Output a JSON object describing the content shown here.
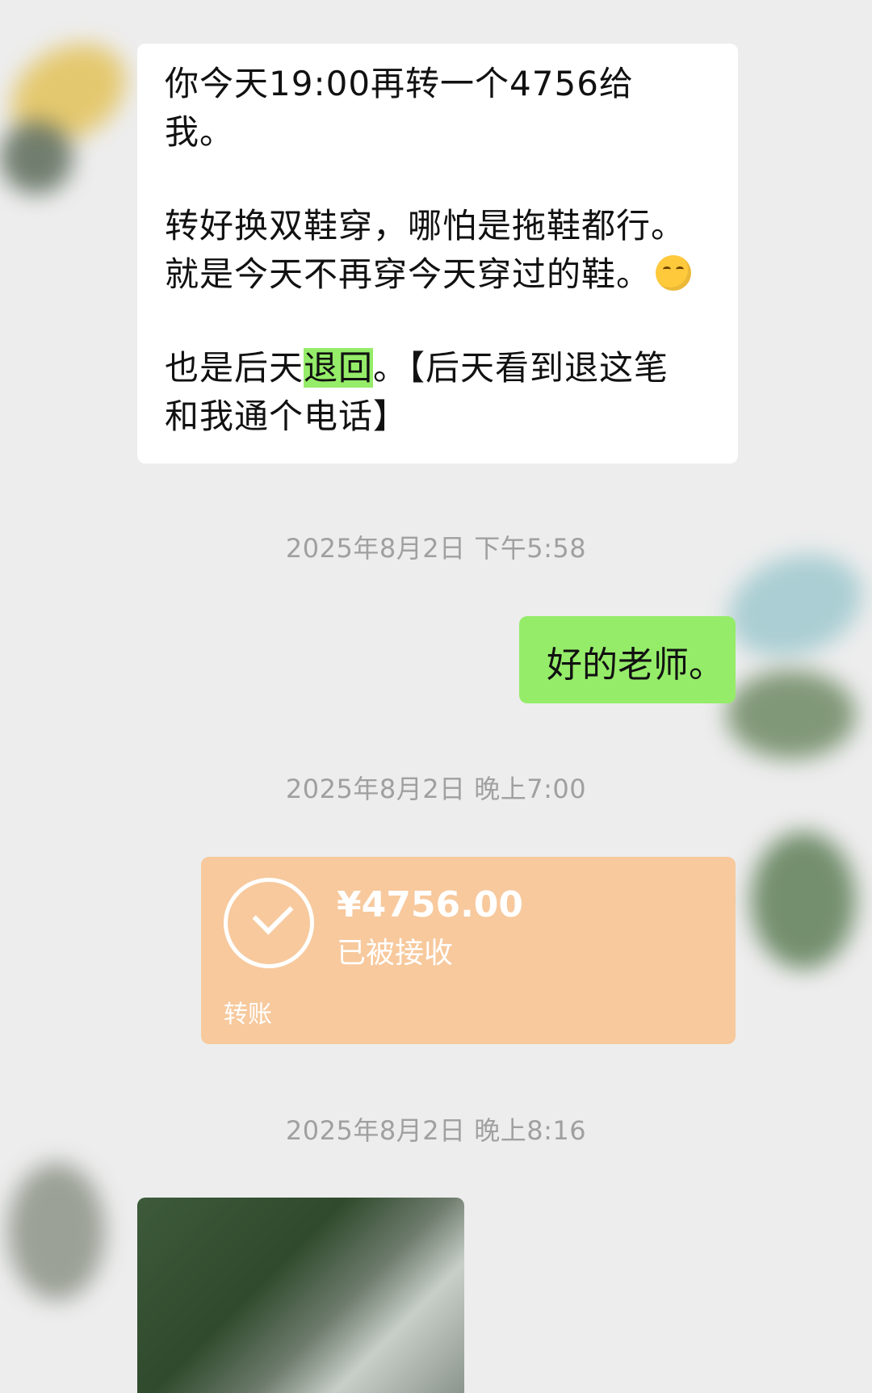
{
  "messages": {
    "incoming": {
      "line1": "你今天19:00再转一个4756给",
      "line2": "我。",
      "line3": "转好换双鞋穿，哪怕是拖鞋都行。",
      "line4": "就是今天不再穿今天穿过的鞋。",
      "line5_before": "也是后天",
      "line5_highlight": "退回",
      "line5_after": "。【后天看到退这笔",
      "line6": "和我通个电话】"
    },
    "outgoing": {
      "text": "好的老师。"
    }
  },
  "timestamps": {
    "t1": "2025年8月2日 下午5:58",
    "t2": "2025年8月2日 晚上7:00",
    "t3": "2025年8月2日 晚上8:16"
  },
  "transfer": {
    "amount": "¥4756.00",
    "status": "已被接收",
    "label": "转账"
  },
  "icons": [
    "emoji-thinking-icon",
    "check-circle-icon"
  ],
  "colors": {
    "background": "#ededed",
    "outgoing_bubble": "#95ec69",
    "transfer_card": "#f7c99d"
  }
}
